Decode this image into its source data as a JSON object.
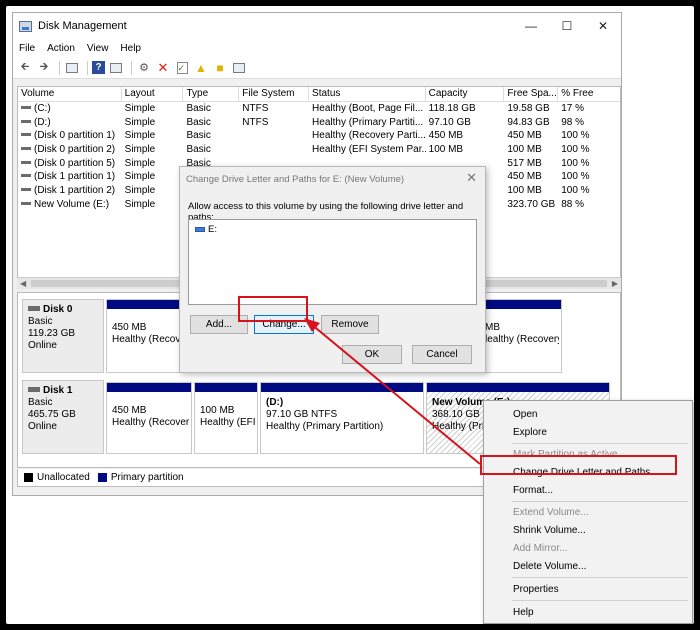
{
  "window": {
    "title": "Disk Management",
    "controls": {
      "minimize": "—",
      "maximize": "☐",
      "close": "✕"
    }
  },
  "menubar": [
    "File",
    "Action",
    "View",
    "Help"
  ],
  "toolbar_icons": [
    "back-icon",
    "forward-icon",
    "list-view-icon",
    "help-icon",
    "properties-icon",
    "connect-icon",
    "delete-icon",
    "check-icon",
    "import-icon",
    "export-icon",
    "view-icon"
  ],
  "volume_list": {
    "headers": [
      "Volume",
      "Layout",
      "Type",
      "File System",
      "Status",
      "Capacity",
      "Free Spa...",
      "% Free"
    ],
    "rows": [
      [
        "(C:)",
        "Simple",
        "Basic",
        "NTFS",
        "Healthy (Boot, Page Fil...",
        "118.18 GB",
        "19.58 GB",
        "17 %"
      ],
      [
        "(D:)",
        "Simple",
        "Basic",
        "NTFS",
        "Healthy (Primary Partiti...",
        "97.10 GB",
        "94.83 GB",
        "98 %"
      ],
      [
        "(Disk 0 partition 1)",
        "Simple",
        "Basic",
        "",
        "Healthy (Recovery Parti...",
        "450 MB",
        "450 MB",
        "100 %"
      ],
      [
        "(Disk 0 partition 2)",
        "Simple",
        "Basic",
        "",
        "Healthy (EFI System Par...",
        "100 MB",
        "100 MB",
        "100 %"
      ],
      [
        "(Disk 0 partition 5)",
        "Simple",
        "Basic",
        "",
        "",
        "",
        "517 MB",
        "100 %"
      ],
      [
        "(Disk 1 partition 1)",
        "Simple",
        "Basic",
        "",
        "",
        "",
        "450 MB",
        "100 %"
      ],
      [
        "(Disk 1 partition 2)",
        "Simple",
        "Basic",
        "",
        "",
        "",
        "100 MB",
        "100 %"
      ],
      [
        "New Volume (E:)",
        "Simple",
        "Basic",
        "",
        "",
        "",
        "323.70 GB",
        "88 %"
      ]
    ]
  },
  "disks": [
    {
      "name": "Disk 0",
      "type": "Basic",
      "size": "119.23 GB",
      "state": "Online"
    },
    {
      "name": "Disk 1",
      "type": "Basic",
      "size": "465.75 GB",
      "state": "Online"
    }
  ],
  "partitions": {
    "d0p1": {
      "name": "",
      "line1": "450 MB",
      "line2": "Healthy (Recov"
    },
    "d0p5": {
      "name": "",
      "line1": "MB",
      "line2": "lealthy (Recovery P"
    },
    "d1p1": {
      "name": "",
      "line1": "450 MB",
      "line2": "Healthy (Recover"
    },
    "d1p2": {
      "name": "",
      "line1": "100 MB",
      "line2": "Healthy (EFI"
    },
    "d1p3": {
      "name": "(D:)",
      "line1": "97.10 GB NTFS",
      "line2": "Healthy (Primary Partition)"
    },
    "d1p4": {
      "name": "New Volume (E:)",
      "line1": "368.10 GB NTF",
      "line2": "Healthy (Prim"
    }
  },
  "legend": {
    "unallocated": "Unallocated",
    "primary": "Primary partition"
  },
  "dialog": {
    "title": "Change Drive Letter and Paths for E: (New Volume)",
    "prompt": "Allow access to this volume by using the following drive letter and paths:",
    "list_item": "E:",
    "add": "Add...",
    "change": "Change...",
    "remove": "Remove",
    "ok": "OK",
    "cancel": "Cancel"
  },
  "context_menu": {
    "open": "Open",
    "explore": "Explore",
    "mark_active": "Mark Partition as Active",
    "change_letter": "Change Drive Letter and Paths...",
    "format": "Format...",
    "extend": "Extend Volume...",
    "shrink": "Shrink Volume...",
    "add_mirror": "Add Mirror...",
    "delete": "Delete Volume...",
    "properties": "Properties",
    "help": "Help"
  },
  "colors": {
    "primary_bar": "#000a82",
    "highlight": "#d8121b"
  }
}
